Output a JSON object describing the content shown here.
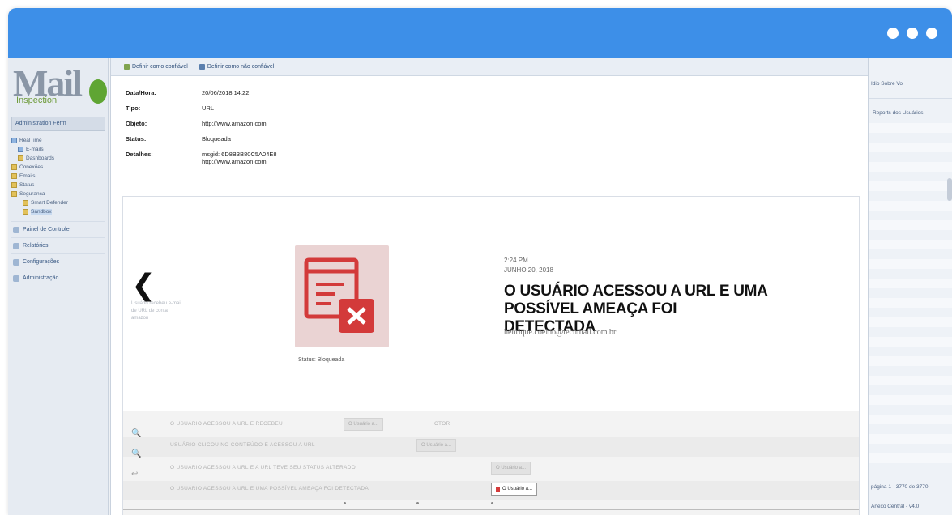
{
  "window": {
    "accent": "#3d8fe8"
  },
  "logo": {
    "big": "Mail",
    "small": "Inspection"
  },
  "sidebar": {
    "header": "Administration Ferm",
    "tree": [
      {
        "label": "RealTime",
        "icon": "folder-icon"
      },
      {
        "label": "E-mails",
        "icon": "mail-icon"
      },
      {
        "label": "Dashboards",
        "icon": "dashboard-icon"
      },
      {
        "label": "Conexões",
        "icon": "folder-icon"
      },
      {
        "label": "Emails",
        "icon": "folder-icon"
      },
      {
        "label": "Status",
        "icon": "folder-icon"
      },
      {
        "label": "Segurança",
        "icon": "folder-icon"
      },
      {
        "label": "Smart Defender",
        "icon": "shield-icon"
      },
      {
        "label": "Sandbox",
        "icon": "sandbox-icon"
      }
    ],
    "nav": [
      {
        "label": "Painel de Controle"
      },
      {
        "label": "Relatórios"
      },
      {
        "label": "Configurações"
      },
      {
        "label": "Administração"
      }
    ]
  },
  "toolbar": {
    "trusted_label": "Definir como confiável",
    "untrusted_label": "Definir como não confiável"
  },
  "details": {
    "date_label": "Data/Hora:",
    "date_value": "20/06/2018 14:22",
    "type_label": "Tipo:",
    "type_value": "URL",
    "object_label": "Objeto:",
    "object_value": "http://www.amazon.com",
    "status_label": "Status:",
    "status_value": "Bloqueada",
    "details_label": "Detalhes:",
    "details_value_1": "msgid: 6D8B3B80C5A04E8",
    "details_value_2": "http://www.amazon.com"
  },
  "event": {
    "status": "Status: Bloqueada",
    "time": "2:24 PM",
    "date": "JUNHO 20, 2018",
    "title": "O USUÁRIO ACESSOU A URL E UMA POSSÍVEL AMEAÇA FOI DETECTADA",
    "email": "henrique.coelho@techmail.com.br",
    "ghost": "Usuário recebeu e-mail de URL de conta amazon"
  },
  "timeline": {
    "rows": [
      "O USUÁRIO ACESSOU A URL E RECEBEU",
      "USUÁRIO CLICOU NO CONTEÚDO E ACESSOU A URL",
      "O USUÁRIO ACESSOU A URL E A URL TEVE SEU STATUS ALTERADO",
      "O USUÁRIO ACESSOU A URL E UMA POSSÍVEL AMEAÇA FOI DETECTADA"
    ],
    "chips": [
      "O Usuário a...",
      "O Usuário a...",
      "O Usuário a...",
      "O Usuário a..."
    ],
    "extra_text": "CTOR"
  },
  "rightpane": {
    "toolbar": "Idio  Sobre  Vo",
    "header": "Reports dos Usuários",
    "foot1": "página 1 - 3770 de 3770",
    "foot2": "Anexo Central - v4.0"
  }
}
